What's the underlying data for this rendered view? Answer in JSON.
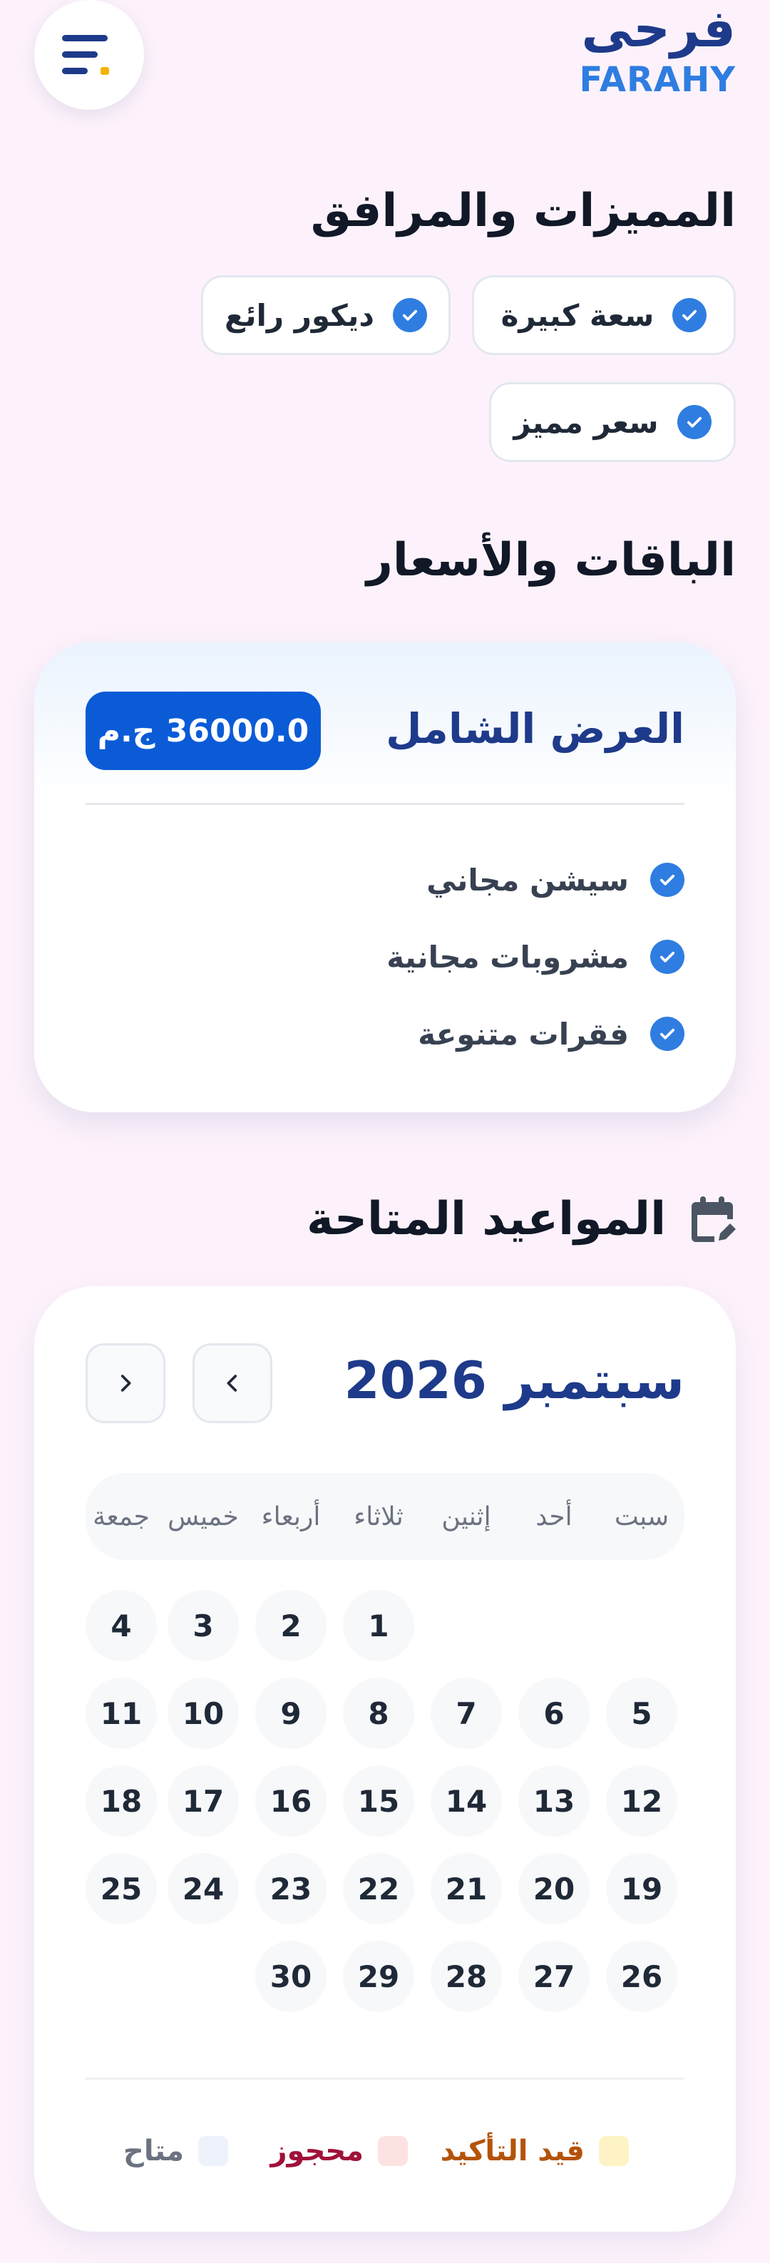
{
  "brand": {
    "arabic": "فرحى",
    "english": "FARAHY"
  },
  "features": {
    "title": "المميزات والمرافق",
    "items": [
      "سعة كبيرة",
      "ديكور رائع",
      "سعر مميز"
    ]
  },
  "packages": {
    "title": "الباقات والأسعار",
    "items": [
      {
        "name": "العرض الشامل",
        "price": "36000.0 ج.م",
        "features": [
          "سيشن مجاني",
          "مشروبات مجانية",
          "فقرات متنوعة"
        ]
      }
    ]
  },
  "dates": {
    "title": "المواعيد المتاحة",
    "month_label": "سبتمبر 2026",
    "weekdays": [
      "سبت",
      "أحد",
      "إثنين",
      "ثلاثاء",
      "أربعاء",
      "خميس",
      "جمعة"
    ],
    "weeks": [
      [
        "",
        "",
        "1",
        "2",
        "3",
        "4"
      ],
      [
        "5",
        "6",
        "7",
        "8",
        "9",
        "10",
        "11"
      ],
      [
        "12",
        "13",
        "14",
        "15",
        "16",
        "17",
        "18"
      ],
      [
        "19",
        "20",
        "21",
        "22",
        "23",
        "24",
        "25"
      ],
      [
        "26",
        "27",
        "28",
        "29",
        "30"
      ]
    ],
    "legend": [
      {
        "label": "قيد التأكيد",
        "color": "#fdf3c4",
        "text_color": "#b45309"
      },
      {
        "label": "محجوز",
        "color": "#fde2e2",
        "text_color": "#9f1239"
      },
      {
        "label": "متاح",
        "color": "#eef2fb",
        "text_color": "#6b7280"
      }
    ]
  },
  "colors": {
    "brand_dark": "#1e3a8a",
    "brand_light": "#2f7de1",
    "accent": "#0b5bd7",
    "menu_accent": "#f5b400",
    "background": "#fdf2fb"
  },
  "icons": {
    "menu": "menu-icon",
    "check": "check-circle-icon",
    "calendar": "calendar-edit-icon",
    "prev": "chevron-left-icon",
    "next": "chevron-right-icon"
  }
}
